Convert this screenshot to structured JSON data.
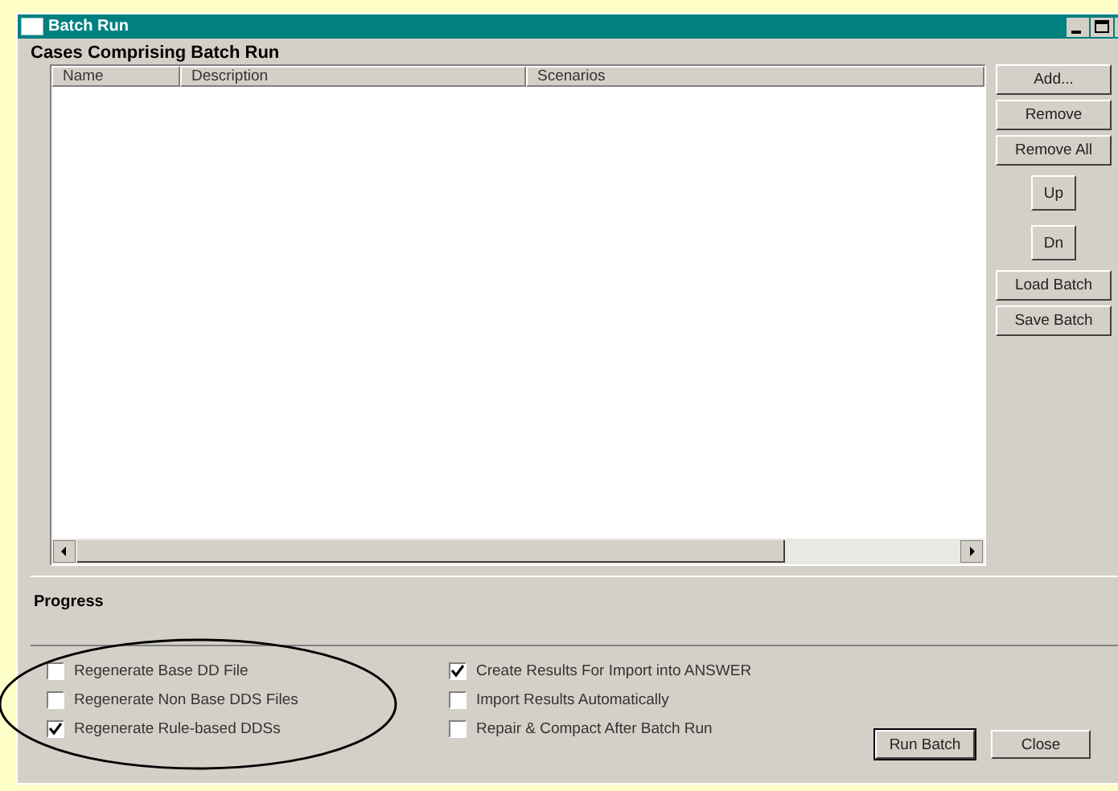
{
  "window": {
    "title": "Batch Run"
  },
  "cases_group": {
    "title": "Cases Comprising Batch Run",
    "columns": [
      "Name",
      "Description",
      "Scenarios"
    ]
  },
  "side_buttons": [
    {
      "label": "Add...",
      "kind": "wide"
    },
    {
      "label": "Remove",
      "kind": "wide"
    },
    {
      "label": "Remove All",
      "kind": "wide"
    },
    {
      "label": "Up",
      "kind": "narrow"
    },
    {
      "label": "Dn",
      "kind": "narrow"
    },
    {
      "label": "Load Batch",
      "kind": "wide"
    },
    {
      "label": "Save Batch",
      "kind": "wide"
    }
  ],
  "progress": {
    "title": "Progress"
  },
  "options_left": [
    {
      "label": "Regenerate Base DD File",
      "checked": false
    },
    {
      "label": "Regenerate Non Base DDS Files",
      "checked": false
    },
    {
      "label": "Regenerate Rule-based DDSs",
      "checked": true
    }
  ],
  "options_right": [
    {
      "label": "Create Results For Import into ANSWER",
      "checked": true
    },
    {
      "label": "Import Results Automatically",
      "checked": false
    },
    {
      "label": "Repair & Compact After Batch Run",
      "checked": false
    }
  ],
  "buttons": [
    {
      "label": "Run Batch",
      "default": true
    },
    {
      "label": "Close",
      "default": false
    }
  ]
}
